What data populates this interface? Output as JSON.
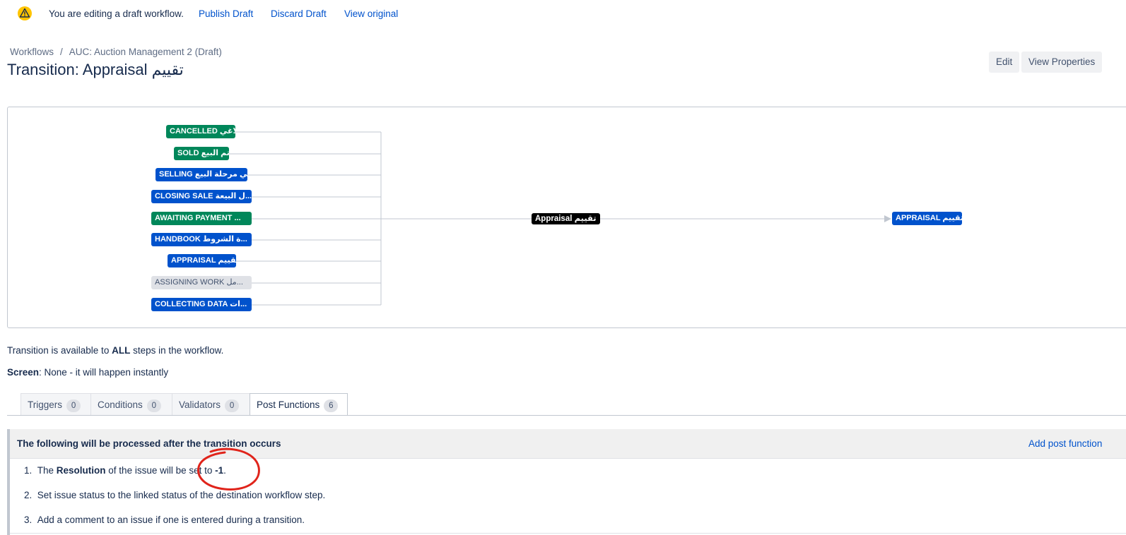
{
  "banner": {
    "icon": "warning-icon",
    "message": "You are editing a draft workflow.",
    "publish": "Publish Draft",
    "discard": "Discard Draft",
    "view_original": "View original"
  },
  "breadcrumb": {
    "workflows": "Workflows",
    "separator": "/",
    "current": "AUC: Auction Management 2 (Draft)"
  },
  "title": "Transition: Appraisal تقييم",
  "actions": {
    "edit": "Edit",
    "view_properties": "View Properties"
  },
  "diagram": {
    "sources": [
      {
        "label": "CANCELLED لاغي",
        "color": "#00875a"
      },
      {
        "label": "SOLD تم البيع",
        "color": "#00875a"
      },
      {
        "label": "SELLING في مرحلة البيع",
        "color": "#0052cc"
      },
      {
        "label": "CLOSING SALE ل البيعة...",
        "color": "#0052cc"
      },
      {
        "label": "AWAITING PAYMENT ...",
        "color": "#00875a"
      },
      {
        "label": "HANDBOOK ة الشروط...",
        "color": "#0052cc"
      },
      {
        "label": "APPRAISAL تقييم",
        "color": "#0052cc"
      },
      {
        "label": "ASSIGNING WORK مل...",
        "color": "#dfe1e6"
      },
      {
        "label": "COLLECTING DATA ات...",
        "color": "#0052cc"
      }
    ],
    "transition_label": "Appraisal تقييم",
    "target": {
      "label": "APPRAISAL تقييم",
      "color": "#0052cc"
    }
  },
  "availability": {
    "prefix": "Transition is available to ",
    "bold": "ALL",
    "suffix": " steps in the workflow."
  },
  "screen": {
    "label": "Screen",
    "value": ": None - it will happen instantly"
  },
  "tabs": [
    {
      "label": "Triggers",
      "count": "0"
    },
    {
      "label": "Conditions",
      "count": "0"
    },
    {
      "label": "Validators",
      "count": "0"
    },
    {
      "label": "Post Functions",
      "count": "6"
    }
  ],
  "post_functions": {
    "header": "The following will be processed after the transition occurs",
    "add_link": "Add post function",
    "items": [
      {
        "num": "1.",
        "pre": "The ",
        "bold1": "Resolution",
        "mid": " of the issue will be set to ",
        "bold2": "-1",
        "post": "."
      },
      {
        "num": "2.",
        "text": "Set issue status to the linked status of the destination workflow step."
      },
      {
        "num": "3.",
        "text": "Add a comment to an issue if one is entered during a transition."
      }
    ]
  },
  "colors": {
    "link": "#0052cc",
    "annotation": "#e0241b"
  }
}
